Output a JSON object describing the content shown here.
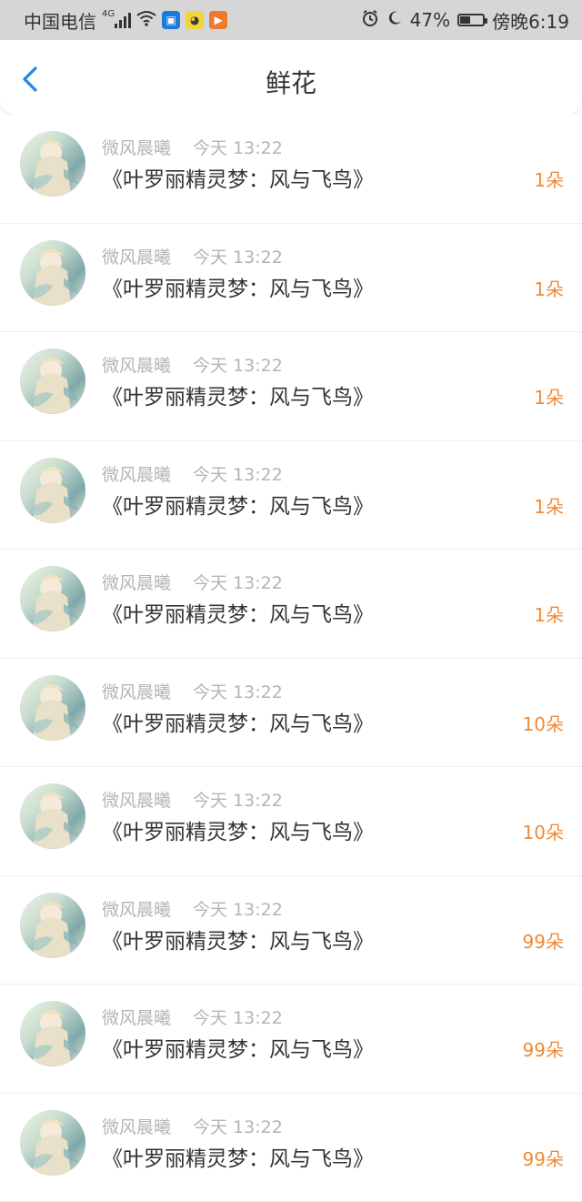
{
  "status_bar": {
    "carrier": "中国电信",
    "network": "4G",
    "battery_percent": "47%",
    "battery_level": 0.47,
    "time": "傍晚6:19",
    "icons": [
      "signal-icon",
      "wifi-icon",
      "shield-app-icon",
      "duck-app-icon",
      "play-app-icon",
      "alarm-icon",
      "moon-icon",
      "battery-icon"
    ],
    "colors": {
      "background": "#d6d6d6"
    }
  },
  "header": {
    "title": "鲜花",
    "back_icon": "chevron-left-icon",
    "accent_color": "#1e88e5"
  },
  "list": {
    "items": [
      {
        "user": "微风晨曦",
        "time": "今天 13:22",
        "title": "《叶罗丽精灵梦：风与飞鸟》",
        "count": "1朵"
      },
      {
        "user": "微风晨曦",
        "time": "今天 13:22",
        "title": "《叶罗丽精灵梦：风与飞鸟》",
        "count": "1朵"
      },
      {
        "user": "微风晨曦",
        "time": "今天 13:22",
        "title": "《叶罗丽精灵梦：风与飞鸟》",
        "count": "1朵"
      },
      {
        "user": "微风晨曦",
        "time": "今天 13:22",
        "title": "《叶罗丽精灵梦：风与飞鸟》",
        "count": "1朵"
      },
      {
        "user": "微风晨曦",
        "time": "今天 13:22",
        "title": "《叶罗丽精灵梦：风与飞鸟》",
        "count": "1朵"
      },
      {
        "user": "微风晨曦",
        "time": "今天 13:22",
        "title": "《叶罗丽精灵梦：风与飞鸟》",
        "count": "10朵"
      },
      {
        "user": "微风晨曦",
        "time": "今天 13:22",
        "title": "《叶罗丽精灵梦：风与飞鸟》",
        "count": "10朵"
      },
      {
        "user": "微风晨曦",
        "time": "今天 13:22",
        "title": "《叶罗丽精灵梦：风与飞鸟》",
        "count": "99朵"
      },
      {
        "user": "微风晨曦",
        "time": "今天 13:22",
        "title": "《叶罗丽精灵梦：风与飞鸟》",
        "count": "99朵"
      },
      {
        "user": "微风晨曦",
        "time": "今天 13:22",
        "title": "《叶罗丽精灵梦：风与飞鸟》",
        "count": "99朵"
      }
    ],
    "colors": {
      "count": "#f08a38",
      "meta": "#b4b4b4",
      "title": "#333333"
    }
  }
}
